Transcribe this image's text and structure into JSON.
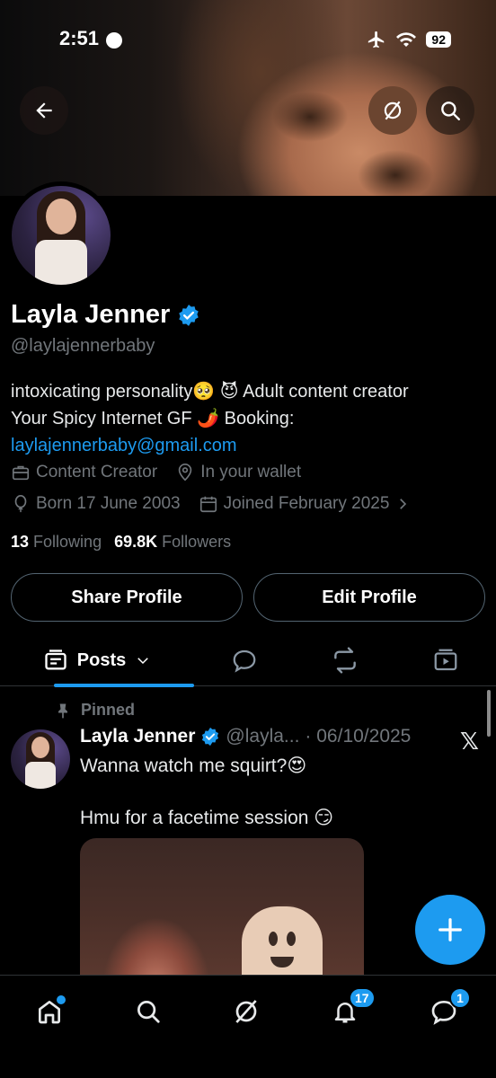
{
  "status_bar": {
    "time": "2:51",
    "battery": "92"
  },
  "profile": {
    "name": "Layla Jenner",
    "handle": "@laylajennerbaby",
    "bio_line1": "intoxicating personality🥺 😈 Adult content creator",
    "bio_line2": "Your Spicy Internet GF 🌶️ Booking:",
    "bio_link": "laylajennerbaby@gmail.com",
    "category": "Content Creator",
    "location": "In your wallet",
    "born": "Born 17 June 2003",
    "joined": "Joined February 2025",
    "following_count": "13",
    "following_label": "Following",
    "followers_count": "69.8K",
    "followers_label": "Followers"
  },
  "buttons": {
    "share": "Share Profile",
    "edit": "Edit Profile"
  },
  "tabs": {
    "posts": "Posts"
  },
  "post": {
    "pinned_label": "Pinned",
    "author": "Layla Jenner",
    "handle": "@layla...",
    "date": "· 06/10/2025",
    "text": "Wanna watch me squirt?😍\n\nHmu for a facetime session 😏"
  },
  "nav": {
    "notifications_badge": "17",
    "messages_badge": "1"
  },
  "colors": {
    "accent": "#1d9bf0",
    "muted": "#71767b",
    "background": "#000000"
  }
}
